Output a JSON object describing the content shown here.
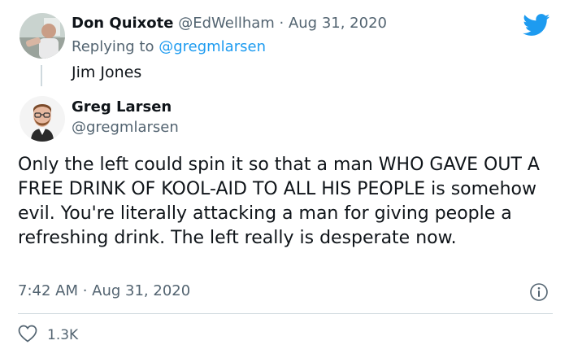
{
  "reply_context": {
    "author_name": "Don Quixote",
    "handle_and_date": "@EdWellham · Aug 31, 2020",
    "replying_prefix": "Replying to",
    "replying_to": "@gregmlarsen",
    "text": "Jim Jones"
  },
  "tweet": {
    "author_name": "Greg Larsen",
    "handle": "@gregmlarsen",
    "text": "Only the left could spin it so that a man WHO GAVE OUT A FREE DRINK OF KOOL-AID TO ALL HIS PEOPLE is somehow evil. You're literally attacking a man for giving people a refreshing drink. The left really is desperate now.",
    "timestamp": "7:42 AM · Aug 31, 2020",
    "like_count": "1.3K"
  },
  "colors": {
    "accent": "#1d9bf0",
    "muted": "#536471",
    "text": "#0f1419",
    "divider": "#cfd9de"
  },
  "icons": {
    "brand": "twitter-bird-icon",
    "info": "info-icon",
    "like": "heart-icon"
  }
}
